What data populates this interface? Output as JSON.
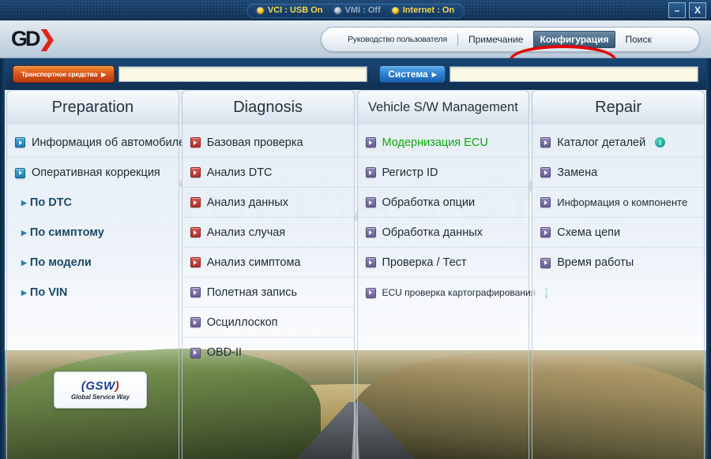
{
  "titlebar": {
    "status": [
      {
        "label": "VCI : USB On",
        "state": "on"
      },
      {
        "label": "VMI : Off",
        "state": "off"
      },
      {
        "label": "Internet : On",
        "state": "on"
      }
    ],
    "minimize_label": "–",
    "close_label": "X"
  },
  "header": {
    "logo_text": "GD",
    "logo_swoosh": "’",
    "tabs": [
      {
        "label": "Руководство пользователя",
        "active": false
      },
      {
        "label": "Примечание",
        "active": false
      },
      {
        "label": "Конфигурация",
        "active": true
      },
      {
        "label": "Поиск",
        "active": false
      }
    ]
  },
  "selectbar": {
    "vehicle_label": "Транспортное средства",
    "vehicle_value": "",
    "system_label": "Система",
    "system_value": "",
    "arrow": "▶"
  },
  "columns": [
    {
      "title": "Preparation",
      "items": [
        {
          "label": "Информация об автомобиле",
          "bullet": "blue",
          "info": true,
          "type": "item"
        },
        {
          "label": "Оперативная коррекция",
          "bullet": "blue",
          "info": false,
          "type": "item",
          "nodot": true
        },
        {
          "label": "По DTC",
          "type": "sub"
        },
        {
          "label": "По симптому",
          "type": "sub"
        },
        {
          "label": "По модели",
          "type": "sub"
        },
        {
          "label": "По VIN",
          "type": "sub"
        }
      ]
    },
    {
      "title": "Diagnosis",
      "items": [
        {
          "label": "Базовая проверка",
          "bullet": "red",
          "info": false,
          "type": "item"
        },
        {
          "label": "Анализ DTC",
          "bullet": "red",
          "info": false,
          "type": "item"
        },
        {
          "label": "Анализ данных",
          "bullet": "red",
          "info": false,
          "type": "item"
        },
        {
          "label": "Анализ случая",
          "bullet": "red",
          "info": false,
          "type": "item"
        },
        {
          "label": "Анализ симптома",
          "bullet": "red",
          "info": false,
          "type": "item"
        },
        {
          "label": "Полетная запись",
          "bullet": "purple",
          "info": false,
          "type": "item"
        },
        {
          "label": "Осциллоскоп",
          "bullet": "purple",
          "info": false,
          "type": "item"
        },
        {
          "label": "OBD-II",
          "bullet": "purple",
          "info": false,
          "type": "item",
          "nodot": true
        }
      ]
    },
    {
      "title": "Vehicle S/W Management",
      "items": [
        {
          "label": "Модернизация ECU",
          "bullet": "purple",
          "info": false,
          "type": "item",
          "green": true
        },
        {
          "label": "Регистр ID",
          "bullet": "purple",
          "info": false,
          "type": "item"
        },
        {
          "label": "Обработка опции",
          "bullet": "purple",
          "info": false,
          "type": "item"
        },
        {
          "label": "Обработка данных",
          "bullet": "purple",
          "info": false,
          "type": "item"
        },
        {
          "label": "Проверка / Тест",
          "bullet": "purple",
          "info": false,
          "type": "item"
        },
        {
          "label": "ECU проверка картографирования",
          "bullet": "purple",
          "info": true,
          "type": "item",
          "tiny": true,
          "nodot": true
        }
      ]
    },
    {
      "title": "Repair",
      "items": [
        {
          "label": "Каталог деталей",
          "bullet": "purple",
          "info": true,
          "type": "item"
        },
        {
          "label": "Замена",
          "bullet": "purple",
          "info": false,
          "type": "item"
        },
        {
          "label": "Информация о компоненте",
          "bullet": "purple",
          "info": false,
          "type": "item",
          "small": true
        },
        {
          "label": "Схема цепи",
          "bullet": "purple",
          "info": false,
          "type": "item"
        },
        {
          "label": "Время работы",
          "bullet": "purple",
          "info": false,
          "type": "item",
          "nodot": true
        }
      ]
    }
  ],
  "badge": {
    "main": "GSW",
    "sub": "Global Service Way"
  },
  "watermark": "TOPDIAG.BY",
  "colors": {
    "accent_red": "#e2231a",
    "active_tab": "#4a6d8c",
    "status_on": "#f6d64a",
    "status_off": "#93a9bd",
    "green_item": "#0fa80f",
    "annotation": "#e00000"
  }
}
